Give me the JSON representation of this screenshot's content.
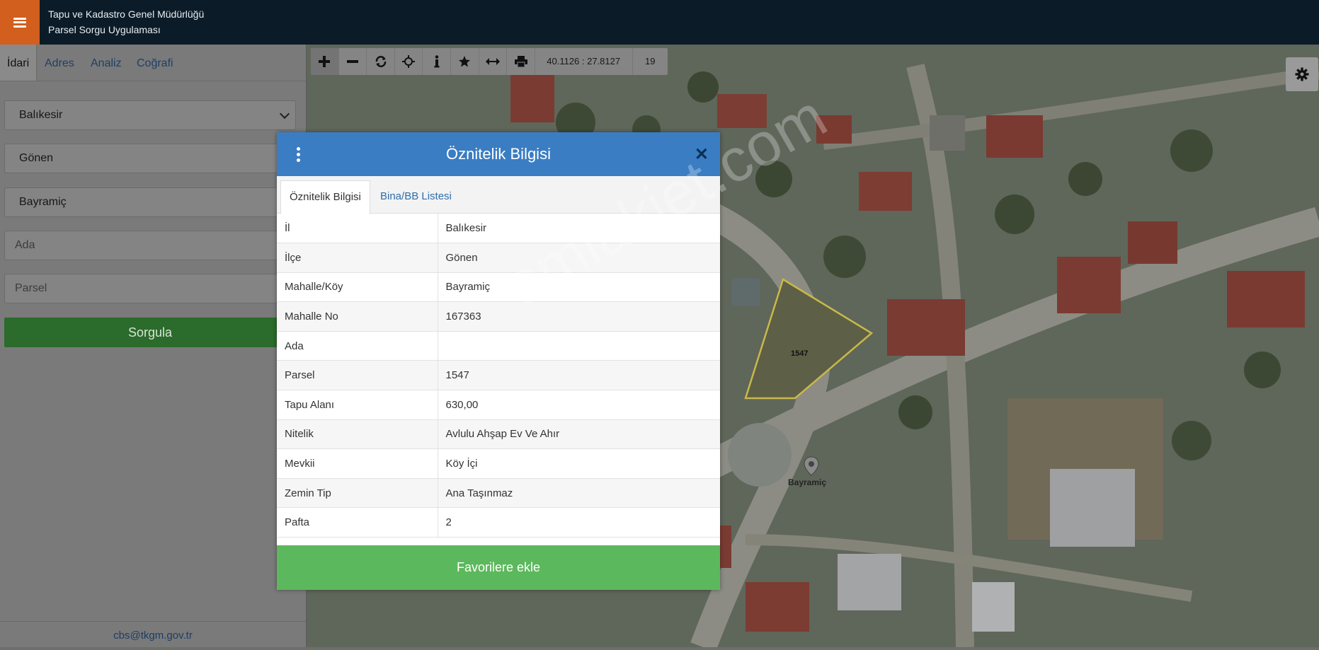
{
  "header": {
    "org_name": "Tapu ve Kadastro Genel Müdürlüğü",
    "app_name": "Parsel Sorgu Uygulaması"
  },
  "sidebar": {
    "tabs": [
      "İdari",
      "Adres",
      "Analiz",
      "Coğrafi"
    ],
    "fields": {
      "il": "Balıkesir",
      "ilce": "Gönen",
      "mahalle": "Bayramiç",
      "ada_placeholder": "Ada",
      "parsel_placeholder": "Parsel"
    },
    "query_button": "Sorgula",
    "footer_email": "cbs@tkgm.gov.tr"
  },
  "toolbar": {
    "buttons": [
      "zoom-in-icon",
      "zoom-out-icon",
      "refresh-icon",
      "locate-icon",
      "info-icon",
      "star-icon",
      "measure-icon",
      "print-icon"
    ],
    "coordinates": "40.1126 : 27.8127",
    "zoom_level": "19"
  },
  "map": {
    "parcel_label": "1547",
    "place_label": "Bayramiç",
    "watermark": "emlakjet.com"
  },
  "modal": {
    "title": "Öznitelik Bilgisi",
    "tabs": [
      "Öznitelik Bilgisi",
      "Bina/BB Listesi"
    ],
    "rows": [
      {
        "key": "İl",
        "value": "Balıkesir"
      },
      {
        "key": "İlçe",
        "value": "Gönen"
      },
      {
        "key": "Mahalle/Köy",
        "value": "Bayramiç"
      },
      {
        "key": "Mahalle No",
        "value": "167363"
      },
      {
        "key": "Ada",
        "value": ""
      },
      {
        "key": "Parsel",
        "value": "1547"
      },
      {
        "key": "Tapu Alanı",
        "value": "630,00"
      },
      {
        "key": "Nitelik",
        "value": "Avlulu Ahşap Ev Ve Ahır"
      },
      {
        "key": "Mevkii",
        "value": "Köy İçi"
      },
      {
        "key": "Zemin Tip",
        "value": "Ana Taşınmaz"
      },
      {
        "key": "Pafta",
        "value": "2"
      }
    ],
    "favorite_button": "Favorilere ekle"
  },
  "colors": {
    "topbar": "#0b1b28",
    "menu_button": "#d25f1e",
    "modal_header": "#3a7dc3",
    "favorite_button": "#5cb85c",
    "query_button": "#2b6b2b"
  }
}
